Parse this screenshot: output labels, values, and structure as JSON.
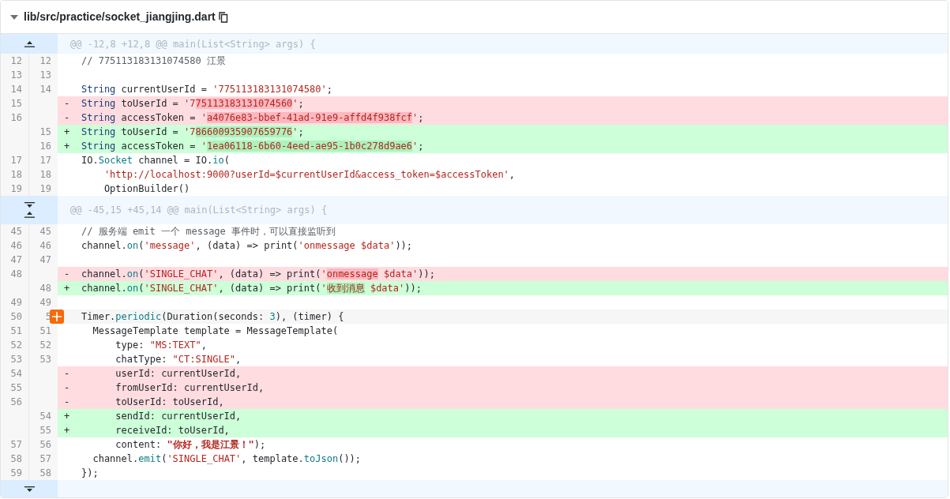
{
  "file": {
    "path": "lib/src/practice/socket_jiangjing.dart",
    "expanded": true
  },
  "rows": [
    {
      "kind": "hunk",
      "expanders": [
        {
          "kind": "up"
        }
      ],
      "text": "@@ -12,8 +12,8 @@ main(List<String> args) {"
    },
    {
      "kind": "context",
      "old": "12",
      "new": "12",
      "tokens": [
        {
          "kind": "cmt",
          "t": "// 775113183131074580 江景"
        }
      ]
    },
    {
      "kind": "context",
      "old": "13",
      "new": "13"
    },
    {
      "kind": "context",
      "old": "14",
      "new": "14",
      "tokens": [
        {
          "kind": "type",
          "t": "String"
        },
        {
          "kind": "plain",
          "t": " currentUserId = "
        },
        {
          "kind": "str",
          "t": "'775113183131074580'"
        },
        {
          "kind": "plain",
          "t": ";"
        }
      ]
    },
    {
      "kind": "del",
      "old": "15",
      "sign": "-",
      "tokens": [
        {
          "kind": "type",
          "t": "String"
        },
        {
          "kind": "plain",
          "t": " toUserId = "
        },
        {
          "kind": "str",
          "t": "'7"
        },
        {
          "kind": "mark",
          "t": "75113183131074560"
        },
        {
          "kind": "str",
          "t": "'"
        },
        {
          "kind": "plain",
          "t": ";"
        }
      ]
    },
    {
      "kind": "del",
      "old": "16",
      "sign": "-",
      "tokens": [
        {
          "kind": "type",
          "t": "String"
        },
        {
          "kind": "plain",
          "t": " accessToken = "
        },
        {
          "kind": "str",
          "t": "'"
        },
        {
          "kind": "mark",
          "t": "a4076e83-bbef-41ad-91e9-affd4f938fcf"
        },
        {
          "kind": "str",
          "t": "'"
        },
        {
          "kind": "plain",
          "t": ";"
        }
      ]
    },
    {
      "kind": "add",
      "new": "15",
      "sign": "+",
      "tokens": [
        {
          "kind": "type",
          "t": "String"
        },
        {
          "kind": "plain",
          "t": " toUserId = "
        },
        {
          "kind": "str",
          "t": "'7"
        },
        {
          "kind": "mark",
          "t": "86600935907659776"
        },
        {
          "kind": "str",
          "t": "'"
        },
        {
          "kind": "plain",
          "t": ";"
        }
      ]
    },
    {
      "kind": "add",
      "new": "16",
      "sign": "+",
      "tokens": [
        {
          "kind": "type",
          "t": "String"
        },
        {
          "kind": "plain",
          "t": " accessToken = "
        },
        {
          "kind": "str",
          "t": "'"
        },
        {
          "kind": "mark",
          "t": "1ea06118-6b60-4eed-ae95-1b0c278d9ae6"
        },
        {
          "kind": "str",
          "t": "'"
        },
        {
          "kind": "plain",
          "t": ";"
        }
      ]
    },
    {
      "kind": "context",
      "old": "17",
      "new": "17",
      "tokens": [
        {
          "kind": "plain",
          "t": "IO."
        },
        {
          "kind": "fn",
          "t": "Socket"
        },
        {
          "kind": "plain",
          "t": " channel = IO."
        },
        {
          "kind": "fn",
          "t": "io"
        },
        {
          "kind": "plain",
          "t": "("
        }
      ]
    },
    {
      "kind": "context",
      "old": "18",
      "new": "18",
      "tokens": [
        {
          "kind": "str",
          "t": "    'http://localhost:9000?userId=$currentUserId&access_token=$accessToken'"
        },
        {
          "kind": "plain",
          "t": ","
        }
      ]
    },
    {
      "kind": "context",
      "old": "19",
      "new": "19",
      "tokens": [
        {
          "kind": "plain",
          "t": "    OptionBuilder()"
        }
      ]
    },
    {
      "kind": "hunk",
      "expanders": [
        {
          "kind": "down"
        },
        {
          "kind": "up"
        }
      ],
      "text": "@@ -45,15 +45,14 @@ main(List<String> args) {"
    },
    {
      "kind": "context",
      "old": "45",
      "new": "45",
      "tokens": [
        {
          "kind": "cmt",
          "t": "// 服务端 emit 一个 message 事件时，可以直接监听到"
        }
      ]
    },
    {
      "kind": "context",
      "old": "46",
      "new": "46",
      "tokens": [
        {
          "kind": "plain",
          "t": "channel."
        },
        {
          "kind": "fn",
          "t": "on"
        },
        {
          "kind": "plain",
          "t": "("
        },
        {
          "kind": "str",
          "t": "'message'"
        },
        {
          "kind": "plain",
          "t": ", (data) => print("
        },
        {
          "kind": "str",
          "t": "'onmessage $data'"
        },
        {
          "kind": "plain",
          "t": "));"
        }
      ]
    },
    {
      "kind": "context",
      "old": "47",
      "new": "47"
    },
    {
      "kind": "del",
      "old": "48",
      "sign": "-",
      "tokens": [
        {
          "kind": "plain",
          "t": "channel."
        },
        {
          "kind": "fn",
          "t": "on"
        },
        {
          "kind": "plain",
          "t": "("
        },
        {
          "kind": "str",
          "t": "'SINGLE_CHAT'"
        },
        {
          "kind": "plain",
          "t": ", (data) => print("
        },
        {
          "kind": "str",
          "t": "'"
        },
        {
          "kind": "mark",
          "t": "onmessage"
        },
        {
          "kind": "str",
          "t": " $data'"
        },
        {
          "kind": "plain",
          "t": "));"
        }
      ]
    },
    {
      "kind": "add",
      "new": "48",
      "sign": "+",
      "tokens": [
        {
          "kind": "plain",
          "t": "channel."
        },
        {
          "kind": "fn",
          "t": "on"
        },
        {
          "kind": "plain",
          "t": "("
        },
        {
          "kind": "str",
          "t": "'SINGLE_CHAT'"
        },
        {
          "kind": "plain",
          "t": ", (data) => print("
        },
        {
          "kind": "str",
          "t": "'"
        },
        {
          "kind": "mark",
          "t": "收到消息"
        },
        {
          "kind": "str",
          "t": " $data'"
        },
        {
          "kind": "plain",
          "t": "));"
        }
      ]
    },
    {
      "kind": "context",
      "old": "49",
      "new": "49"
    },
    {
      "kind": "context",
      "old": "50",
      "new": "5",
      "comment_button": true,
      "tokens": [
        {
          "kind": "plain",
          "t": "Timer."
        },
        {
          "kind": "fn",
          "t": "periodic"
        },
        {
          "kind": "plain",
          "t": "(Duration(seconds: "
        },
        {
          "kind": "num",
          "t": "3"
        },
        {
          "kind": "plain",
          "t": "), (timer) {"
        }
      ]
    },
    {
      "kind": "context",
      "old": "51",
      "new": "51",
      "tokens": [
        {
          "kind": "plain",
          "t": "  MessageTemplate template = MessageTemplate("
        }
      ]
    },
    {
      "kind": "context",
      "old": "52",
      "new": "52",
      "tokens": [
        {
          "kind": "plain",
          "t": "      type: "
        },
        {
          "kind": "str",
          "t": "\"MS:TEXT\""
        },
        {
          "kind": "plain",
          "t": ","
        }
      ]
    },
    {
      "kind": "context",
      "old": "53",
      "new": "53",
      "tokens": [
        {
          "kind": "plain",
          "t": "      chatType: "
        },
        {
          "kind": "str",
          "t": "\"CT:SINGLE\""
        },
        {
          "kind": "plain",
          "t": ","
        }
      ]
    },
    {
      "kind": "del",
      "old": "54",
      "sign": "-",
      "tokens": [
        {
          "kind": "plain",
          "t": "      userId: currentUserId,"
        }
      ]
    },
    {
      "kind": "del",
      "old": "55",
      "sign": "-",
      "tokens": [
        {
          "kind": "plain",
          "t": "      fromUserId: currentUserId,"
        }
      ]
    },
    {
      "kind": "del",
      "old": "56",
      "sign": "-",
      "tokens": [
        {
          "kind": "plain",
          "t": "      toUserId: toUserId,"
        }
      ]
    },
    {
      "kind": "add",
      "new": "54",
      "sign": "+",
      "tokens": [
        {
          "kind": "plain",
          "t": "      sendId: currentUserId,"
        }
      ]
    },
    {
      "kind": "add",
      "new": "55",
      "sign": "+",
      "tokens": [
        {
          "kind": "plain",
          "t": "      receiveId: toUserId,"
        }
      ]
    },
    {
      "kind": "context",
      "old": "57",
      "new": "56",
      "tokens": [
        {
          "kind": "plain",
          "t": "      content: "
        },
        {
          "kind": "strbold",
          "t": "\"你好，我是江景！\""
        },
        {
          "kind": "plain",
          "t": ");"
        }
      ]
    },
    {
      "kind": "context",
      "old": "58",
      "new": "57",
      "tokens": [
        {
          "kind": "plain",
          "t": "  channel."
        },
        {
          "kind": "fn",
          "t": "emit"
        },
        {
          "kind": "plain",
          "t": "("
        },
        {
          "kind": "str",
          "t": "'SINGLE_CHAT'"
        },
        {
          "kind": "plain",
          "t": ", template."
        },
        {
          "kind": "fn",
          "t": "toJson"
        },
        {
          "kind": "plain",
          "t": "());"
        }
      ]
    },
    {
      "kind": "context",
      "old": "59",
      "new": "58",
      "tokens": [
        {
          "kind": "plain",
          "t": "});"
        }
      ]
    },
    {
      "kind": "hunk",
      "expanders": [
        {
          "kind": "down"
        }
      ]
    }
  ]
}
